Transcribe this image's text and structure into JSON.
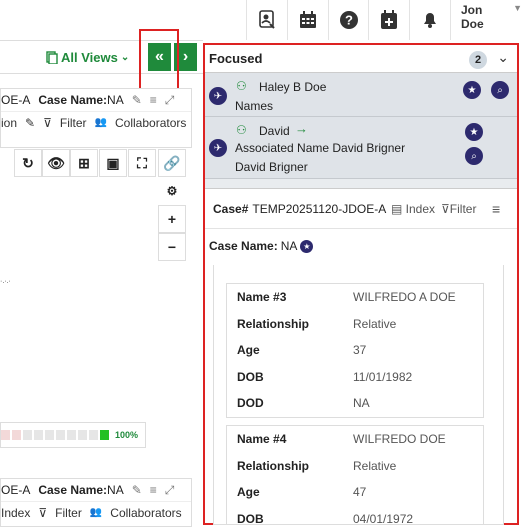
{
  "topbar": {
    "user_name": "Jon Doe"
  },
  "left": {
    "all_views_label": "All Views",
    "card1": {
      "case_id_fragment": "OE-A",
      "case_name_label": "Case Name:",
      "case_name_value": "NA",
      "tools": [
        "ion",
        "Filter",
        "Collaborators"
      ]
    },
    "progress_label": "100%",
    "card2": {
      "case_id_fragment": "OE-A",
      "case_name_label": "Case Name:",
      "case_name_value": "NA",
      "tools": [
        "Index",
        "Filter",
        "Collaborators"
      ]
    }
  },
  "focused": {
    "title": "Focused",
    "count": "2",
    "persons": [
      {
        "name": "Haley B Doe",
        "sub": "Names"
      },
      {
        "name": "David",
        "sub1": "Associated Name David Brigner",
        "sub2": "David Brigner"
      }
    ],
    "case_label": "Case#",
    "case_id": "TEMP20251120-JDOE-A",
    "index_label": "Index",
    "filter_label": "Filter",
    "case_name_label": "Case Name:",
    "case_name_value": "NA",
    "records": [
      {
        "fields": [
          {
            "k": "Name #3",
            "v": "WILFREDO A DOE"
          },
          {
            "k": "Relationship",
            "v": "Relative"
          },
          {
            "k": "Age",
            "v": "37"
          },
          {
            "k": "DOB",
            "v": "11/01/1982"
          },
          {
            "k": "DOD",
            "v": "NA"
          }
        ]
      },
      {
        "fields": [
          {
            "k": "Name #4",
            "v": "WILFREDO DOE"
          },
          {
            "k": "Relationship",
            "v": "Relative"
          },
          {
            "k": "Age",
            "v": "47"
          },
          {
            "k": "DOB",
            "v": "04/01/1972"
          }
        ]
      }
    ]
  }
}
